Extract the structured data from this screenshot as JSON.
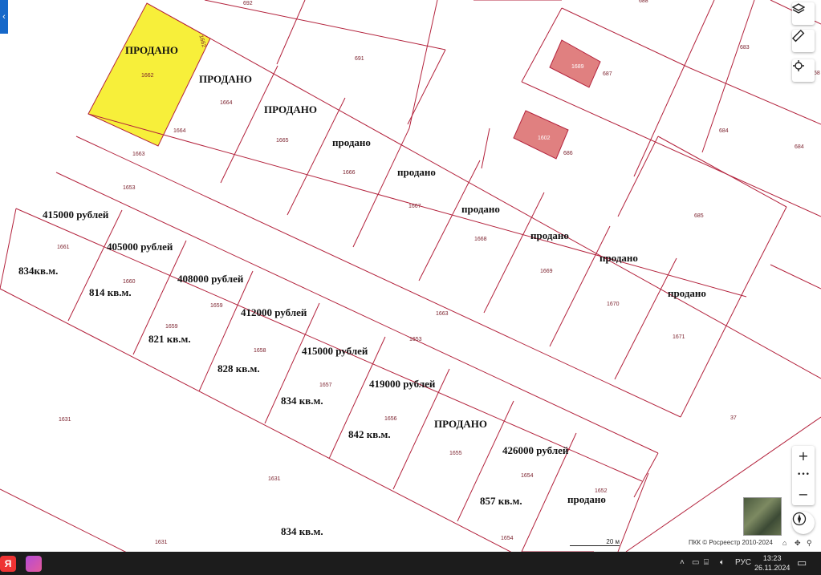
{
  "side_tab": {
    "icon": "chevron-left-icon",
    "glyph": "‹"
  },
  "colors": {
    "boundary": "#b3223c",
    "sold_parcel": "#f7ef3a",
    "building": "#e08080",
    "parcel_number": "#7a1f2b"
  },
  "parcel_numbers": {
    "p692": "692",
    "p688": "688",
    "p691": "691",
    "p1662": "1662",
    "p1662b": "1662",
    "p1664a": "1664",
    "p1664b": "1664",
    "p1665": "1665",
    "p1666": "1666",
    "p1663a": "1663",
    "p1653a": "1653",
    "p1667": "1667",
    "p1668": "1668",
    "p1669": "1669",
    "p1670": "1670",
    "p1671": "1671",
    "p1661": "1661",
    "p1660": "1660",
    "p1659a": "1659",
    "p1659b": "1659",
    "p1658": "1658",
    "p1657": "1657",
    "p1656": "1656",
    "p1655": "1655",
    "p1654a": "1654",
    "p1654b": "1654",
    "p1652": "1652",
    "p1663b": "1663",
    "p1653b": "1653",
    "p1631a": "1631",
    "p1631b": "1631",
    "p1631c": "1631",
    "p683": "683",
    "p684a": "684",
    "p684b": "684",
    "p685": "685",
    "p686": "686",
    "p687": "687",
    "p37": "37",
    "p1689": "1689",
    "p1602": "1602",
    "p58": "58"
  },
  "labels": {
    "sold1": "ПРОДАНО",
    "sold2": "ПРОДАНО",
    "sold3": "ПРОДАНО",
    "sold4": "продано",
    "sold5": "продано",
    "sold6": "продано",
    "sold7": "продано",
    "sold8": "продано",
    "sold9": "продано",
    "sold10": "ПРОДАНО",
    "sold11": "продано",
    "price1": "415000 рублей",
    "area1": "834кв.м.",
    "price2": "405000 рублей",
    "area2": "814 кв.м.",
    "price3": "408000 рублей",
    "area3": "821 кв.м.",
    "price4": "412000 рублей",
    "area4": "828 кв.м.",
    "price5": "415000 рублей",
    "area5": "834 кв.м.",
    "price6": "419000 рублей",
    "area6": "842 кв.м.",
    "price7": "426000 рублей",
    "area7": "857 кв.м.",
    "area8": "834 кв.м."
  },
  "map_controls": {
    "layers_icon": "layers-icon",
    "ruler_icon": "ruler-icon",
    "locate_icon": "crosshair-icon",
    "zoom_in": "+",
    "more": "•••",
    "zoom_out": "−",
    "compass_icon": "compass-icon"
  },
  "scale_label": "20 м",
  "attribution": "ПКК © Росреестр 2010-2024",
  "taskbar": {
    "start": "Я",
    "language": "РУС",
    "time": "13:23",
    "date": "26.11.2024"
  }
}
